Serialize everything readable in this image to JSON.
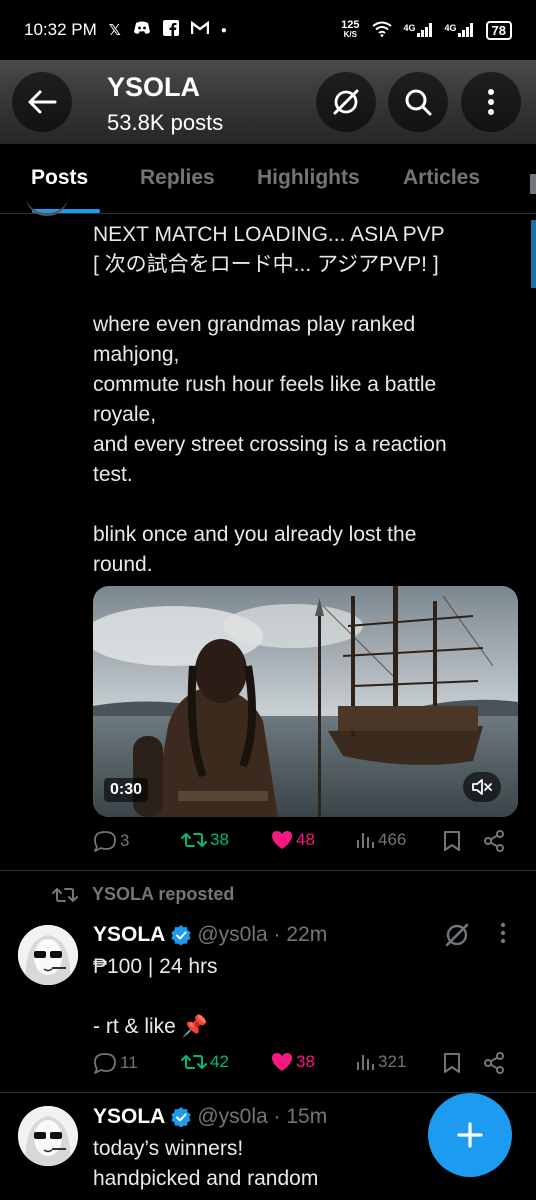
{
  "status_bar": {
    "time": "10:32 PM",
    "notif_icons": [
      "x-icon",
      "discord-icon",
      "facebook-icon",
      "gmail-icon"
    ],
    "speed_value": "125",
    "speed_unit": "K/S",
    "net1": "4G",
    "net2": "4G",
    "battery": "78"
  },
  "header": {
    "title": "YSOLA",
    "subtitle": "53.8K posts"
  },
  "tabs": [
    "Posts",
    "Replies",
    "Highlights",
    "Articles"
  ],
  "post1": {
    "text": "NEXT MATCH LOADING... ASIA PVP\n[ 次の試合をロード中... アジアPVP! ]\n\nwhere even grandmas play ranked\nmahjong,\ncommute rush hour feels like a battle\nroyale,\nand every street crossing is a reaction\ntest.\n\nblink once and you already lost the\nround.",
    "video_duration": "0:30",
    "replies": "3",
    "reposts": "38",
    "likes": "48",
    "views": "466"
  },
  "repost_label": "YSOLA reposted",
  "post2": {
    "name": "YSOLA",
    "handle": "@ys0la · 22m",
    "text": "₱100 | 24 hrs\n\n- rt & like 📌",
    "replies": "11",
    "reposts": "42",
    "likes": "38",
    "views": "321"
  },
  "post3": {
    "name": "YSOLA",
    "handle": "@ys0la · 15m",
    "text": "today’s winners!\nhandpicked and random"
  },
  "colors": {
    "accent": "#1d9bf0",
    "repost": "#00ba7c",
    "like": "#f91880",
    "muted": "#71767b"
  }
}
